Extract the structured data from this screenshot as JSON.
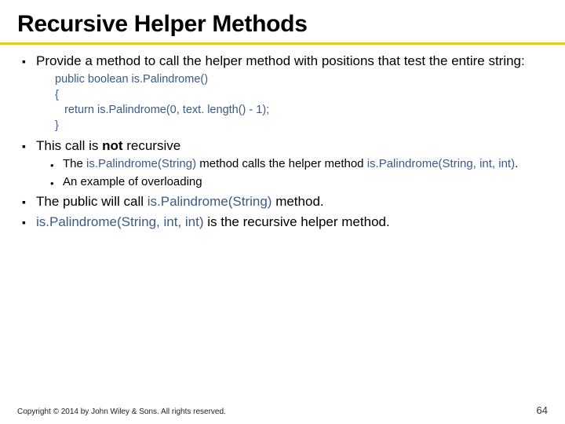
{
  "title": "Recursive Helper Methods",
  "bullets": {
    "b1": "Provide a method to call the helper method with positions that test the entire string:",
    "code": "public boolean is.Palindrome()\n{\n   return is.Palindrome(0, text. length() - 1);\n}",
    "b2_pre": "This call is ",
    "b2_bold": "not",
    "b2_post": " recursive",
    "b2s1_a": "The ",
    "b2s1_b": "is.Palindrome(String)",
    "b2s1_c": " method calls the helper method ",
    "b2s1_d": "is.Palindrome(String, int, int)",
    "b2s1_e": ".",
    "b2s2": "An example of overloading",
    "b3_a": "The public will call ",
    "b3_b": "is.Palindrome(String)",
    "b3_c": " method.",
    "b4_a": "is.Palindrome(String, int, int)",
    "b4_b": " is the recursive helper method."
  },
  "footer": {
    "copyright": "Copyright © 2014 by John Wiley & Sons. All rights reserved.",
    "page": "64"
  }
}
